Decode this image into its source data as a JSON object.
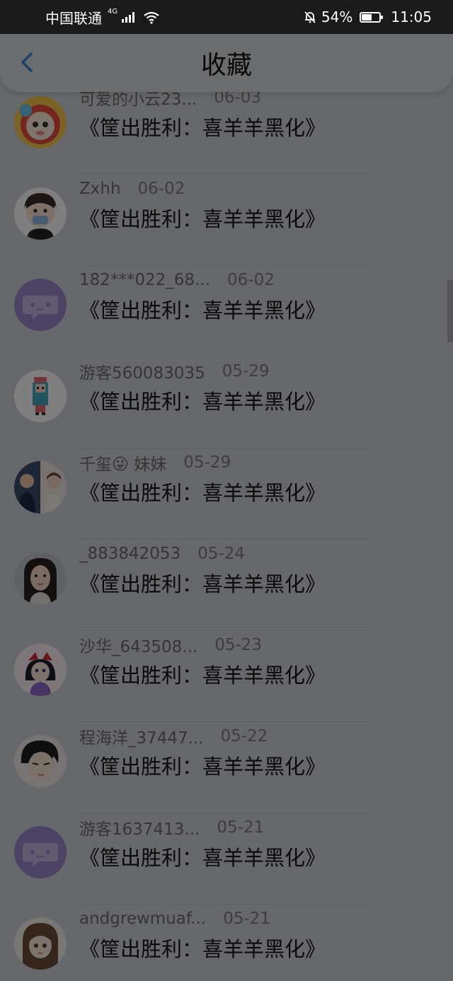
{
  "status_bar": {
    "carrier": "中国联通",
    "network": "4G",
    "battery_percent": "54%",
    "battery_level": 0.54,
    "time": "11:05"
  },
  "header": {
    "title": "收藏",
    "back_icon": "chevron-left-icon"
  },
  "colors": {
    "accent": "#2f86d6",
    "placeholder_avatar": "#9b87c9"
  },
  "items": [
    {
      "user": "可爱的小云23...",
      "date": "06-03",
      "work": "《筐出胜利：喜羊羊黑化》",
      "avatar": "cartoon-sheep-avatar"
    },
    {
      "user": "Zxhh",
      "date": "06-02",
      "work": "《筐出胜利：喜羊羊黑化》",
      "avatar": "masked-boy-avatar"
    },
    {
      "user": "182***022_68...",
      "date": "06-02",
      "work": "《筐出胜利：喜羊羊黑化》",
      "avatar": "default-chat-avatar"
    },
    {
      "user": "游客560083035",
      "date": "05-29",
      "work": "《筐出胜利：喜羊羊黑化》",
      "avatar": "pixel-girl-avatar"
    },
    {
      "user": "千玺😜 妹妹",
      "date": "05-29",
      "work": "《筐出胜利：喜羊羊黑化》",
      "avatar": "photo-collage-avatar"
    },
    {
      "user": "_883842053",
      "date": "05-24",
      "work": "《筐出胜利：喜羊羊黑化》",
      "avatar": "girl-photo-avatar"
    },
    {
      "user": "沙华_643508...",
      "date": "05-23",
      "work": "《筐出胜利：喜羊羊黑化》",
      "avatar": "anime-girl-avatar"
    },
    {
      "user": "程海洋_37447...",
      "date": "05-22",
      "work": "《筐出胜利：喜羊羊黑化》",
      "avatar": "anime-boy-avatar"
    },
    {
      "user": "游客1637413...",
      "date": "05-21",
      "work": "《筐出胜利：喜羊羊黑化》",
      "avatar": "default-chat-avatar"
    },
    {
      "user": "andgrewmuaf...",
      "date": "05-21",
      "work": "《筐出胜利：喜羊羊黑化》",
      "avatar": "anime-doll-avatar"
    }
  ]
}
